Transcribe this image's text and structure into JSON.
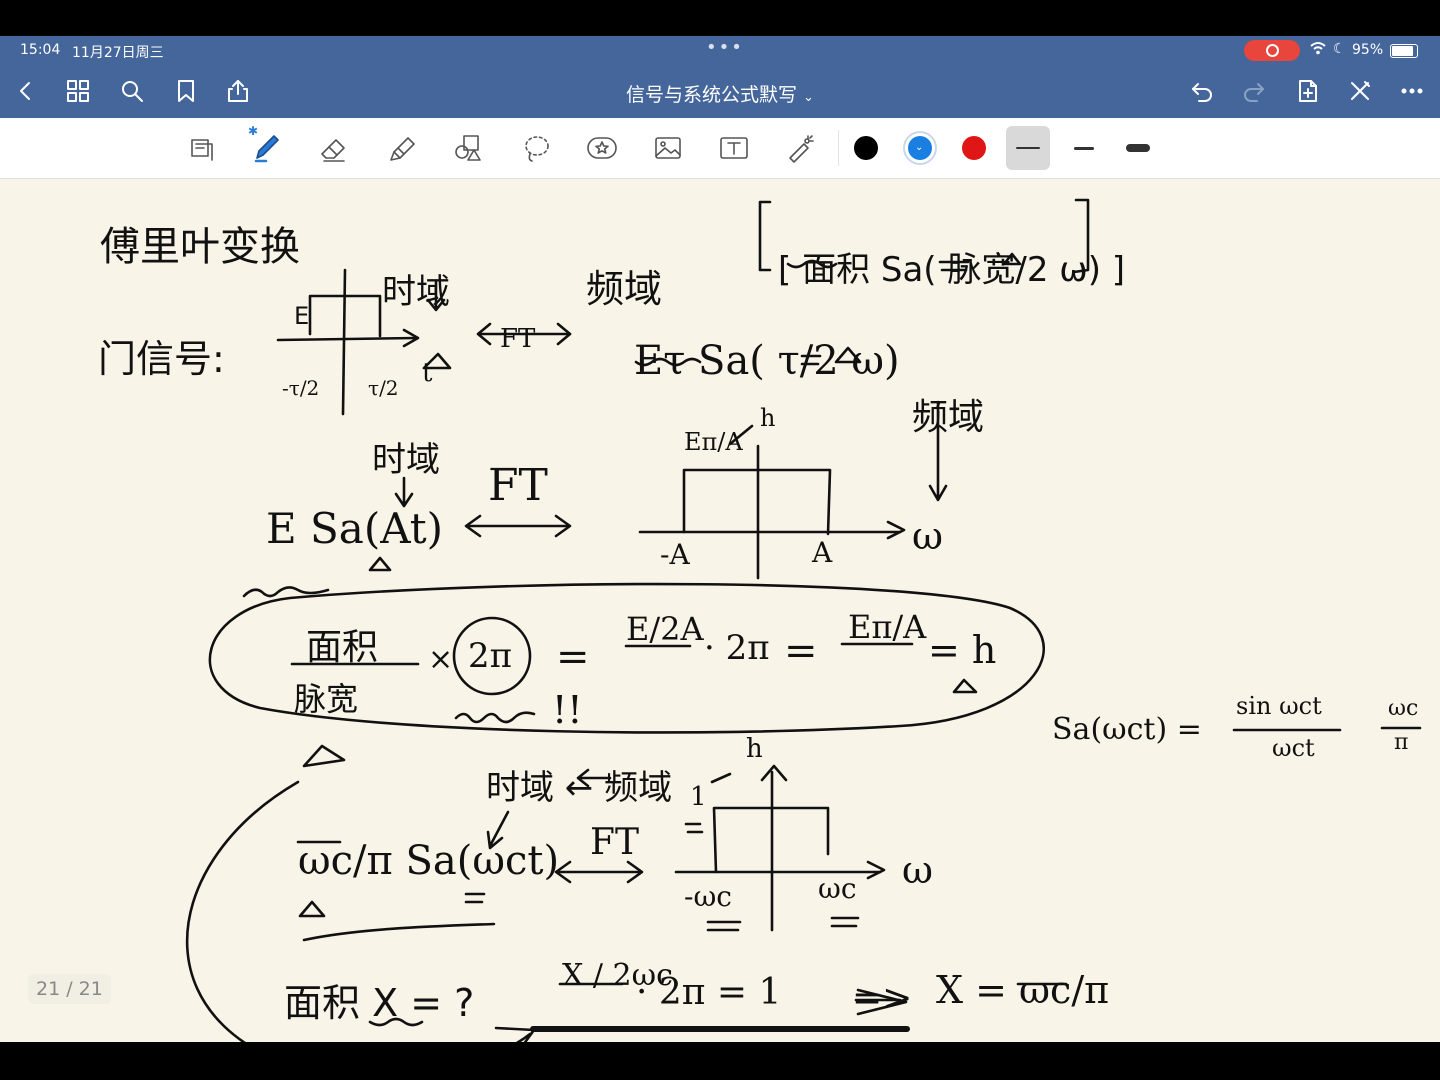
{
  "status": {
    "time": "15:04",
    "date": "11月27日周三",
    "battery": "95%",
    "battery_level": 0.95,
    "dots": "•••"
  },
  "navbar": {
    "title": "信号与系统公式默写",
    "title_chevron": "⌄"
  },
  "toolbar": {
    "colors": [
      "#000000",
      "#1a7fe0",
      "#e01515"
    ],
    "selected_color": "#1a7fe0",
    "stroke_widths": [
      "thin",
      "medium",
      "thick"
    ],
    "selected_stroke": "thin"
  },
  "notes": {
    "title": "傅里叶变换",
    "time_domain": "时域",
    "freq_domain": "频域",
    "bracket_formula": "[ 面积 Sa( 脉宽/2 ω) ]",
    "gate_signal": "门信号:",
    "gate_E": "E",
    "gate_neg": "-τ/2",
    "gate_pos": "τ/2",
    "gate_t": "t",
    "ft1": "FT",
    "gate_result": "Eτ Sa( τ/2 ω)",
    "sa_signal": "E Sa(At)",
    "ft2": "FT",
    "rect_height": "Eπ/A",
    "h_label": "h",
    "rect_w": "ω",
    "rect_negA": "-A",
    "rect_posA": "A",
    "area_top": "面积",
    "area_bottom": "脉宽",
    "times": "×",
    "two_pi": "2π",
    "eq1": "=",
    "e_over_2a": "E/2A",
    "dot_2pi": "· 2π",
    "eq2": "=",
    "e_pi_a": "Eπ/A",
    "eq_h": "= h",
    "bangs": "!!",
    "sa_def_left": "Sa(ωct) =",
    "sa_def_frac_top": "sin ωct",
    "sa_def_frac_bottom": "ωct",
    "sa_def_tail_top": "ωc",
    "sa_def_tail_bottom": "π",
    "time_from_freq": "时域 ← 频域",
    "lp_h": "h",
    "lp_one": "1",
    "lp_signal": "ωc/π Sa(ωct)",
    "ft3": "FT",
    "lp_w": "ω",
    "lp_neg": "-ωc",
    "lp_pos": "ωc",
    "area_q": "面积 X = ?",
    "calc_frac": "X / 2ωc",
    "calc_dot": "· 2π = 1",
    "implies": "=>",
    "result": "X = ωc/π"
  },
  "page_indicator": "21 / 21"
}
